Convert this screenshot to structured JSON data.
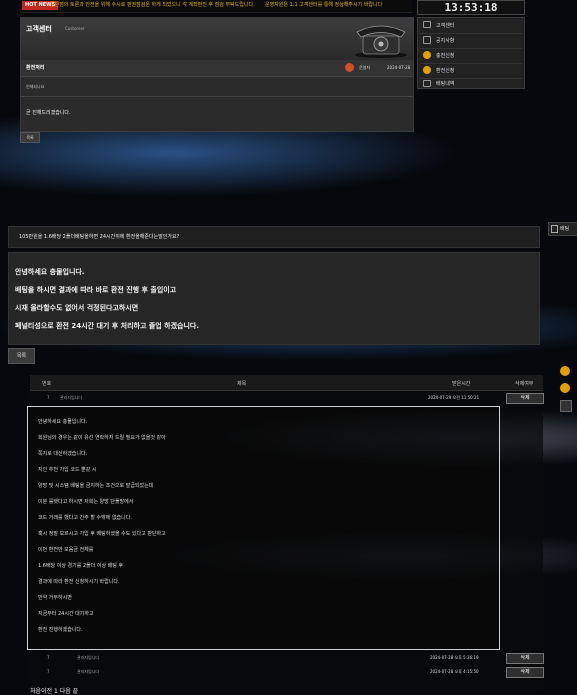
{
  "topbar": {
    "hot_label": "HOT NEWS",
    "notice_1": "중단점의 토론과 안전을 위해 수시로 판권점검은 하게 되었으니 각 계좌판진 후 점검 부탁드립니다.",
    "notice_2": "운영자원은 1:1 고객센터를 통해 정상해주시기 바랍니다"
  },
  "clock": "13:53:18",
  "customer_center": {
    "title": "고객센터",
    "subtitle": "Customer",
    "post_title": "환전처리",
    "post_author": "운영자",
    "post_date": "2024-07-28",
    "question": "인체되나요",
    "answer": "곧 진해드리겠습니다.",
    "list_button": "목록"
  },
  "right_menu": [
    {
      "label": "고객센터",
      "icon": "monitor-icon",
      "color": "#999999"
    },
    {
      "label": "공지사항",
      "icon": "list-icon",
      "color": "#999999"
    },
    {
      "label": "충전신청",
      "icon": "coin-icon",
      "color": "#e0a000"
    },
    {
      "label": "환전신청",
      "icon": "coin-icon",
      "color": "#e0a000"
    },
    {
      "label": "배팅내역",
      "icon": "list-icon",
      "color": "#999999"
    }
  ],
  "detail": {
    "question": "105만원을 1.6배당 2폴더배팅을하면 24시간뒤에 환전을해준다는말인가요?",
    "answer_lines": [
      "안녕하세요 충물입니다.",
      "배팅을 하시면 결과에 따라 바로 환전 진행 후 출입이고",
      "시재 올라할수도 없어서 걱정된다고하시면",
      "페널티성으로 환전 24시간 대기 후 처리하고 졸업 하겠습니다."
    ],
    "list_button": "목록",
    "right_tab": "배팅"
  },
  "table": {
    "headers": [
      "번호",
      "제목",
      "받은시간",
      "삭제여부"
    ],
    "rows": [
      {
        "no": "7",
        "title": "관리자입니다",
        "time": "2024-07-29 오전 11:50:21",
        "delete": "삭제"
      },
      {
        "no": "7",
        "title": "관리자입니다",
        "time": "2024-07-28 오후 5:36:19",
        "delete": "삭제"
      },
      {
        "no": "7",
        "title": "관리자입니다",
        "time": "2024-07-28 오후 4:15:50",
        "delete": "삭제"
      }
    ],
    "message_lines": [
      "안녕하세요 충물입니다.",
      "회원님의 경우는 같이 유선 연락하지 드릴 필요가 없을것 같아",
      "쪽지로 대신하겠습니다.",
      "지인 추천 가입 코드 뿐같 시",
      "양방 및 시스템 배팅을 금지하는 조건으로 발급되었는데",
      "이분 룰렛다고 하시면 저희는 양방 단폴방에서",
      "코드 거래를 했다고 간주 할 수밖에 없습니다.",
      "혹시 정말 모르시고 가입 후 배팅하셨을 수도 있다고 판단하고",
      "이번 환전만 모음금 전체를",
      "1.6배당 이상 경기를 2폴더 이상 배팅 후",
      "결과에 따라 환전 신청하시기 바랍니다.",
      "만약 거부하시면",
      "지금부터 24시간 대기하고",
      "환전 진행하겠습니다."
    ]
  },
  "pager": "처음이전 1 다음 끝"
}
